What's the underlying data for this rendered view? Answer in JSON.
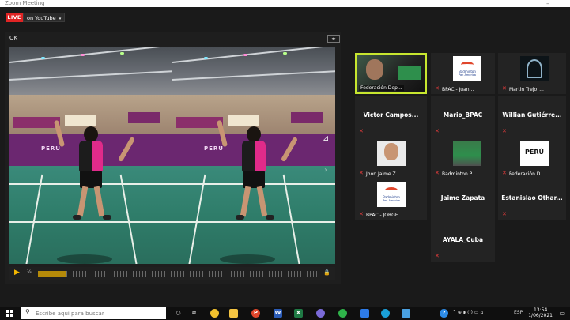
{
  "window": {
    "title": "Zoom Meeting",
    "minimize": "–"
  },
  "live": {
    "badge": "LIVE",
    "platform_button": "on YouTube",
    "caret": "▾"
  },
  "share": {
    "ok_label": "OK",
    "view_button": "◂▸",
    "controls": {
      "play": "▶",
      "speed": "¼",
      "progress_fraction": 0.1,
      "lock": "🔒"
    },
    "video_text": {
      "banner_logo": "PERU"
    }
  },
  "participants": [
    {
      "label": "Federación Dep...",
      "type": "video",
      "active": true,
      "muted": false
    },
    {
      "label": "BPAC - Juan...",
      "type": "logo",
      "muted": true
    },
    {
      "label": "Martin Trejo_...",
      "type": "logo",
      "muted": true
    },
    {
      "name": "Victor Campos...",
      "type": "name",
      "muted": true
    },
    {
      "name": "Mario_BPAC",
      "type": "name",
      "muted": true
    },
    {
      "name": "Willian Gutiérre...",
      "type": "name",
      "muted": true
    },
    {
      "label": "Jhon Jaime Z...",
      "type": "photo",
      "muted": true
    },
    {
      "label": "Badminton P...",
      "type": "photo",
      "muted": true
    },
    {
      "label": "Federación D...",
      "type": "logo",
      "muted": true
    },
    {
      "label": "BPAC - JORGE",
      "type": "logo",
      "muted": true
    },
    {
      "name": "Jaime Zapata",
      "type": "name",
      "muted": false
    },
    {
      "name": "Estanislao Othar...",
      "type": "name",
      "muted": true
    },
    {
      "name": "AYALA_Cuba",
      "type": "name",
      "muted": true
    }
  ],
  "logos": {
    "bpac_line1": "Badminton",
    "bpac_line2": "Pan America",
    "peru": "PERÚ"
  },
  "taskbar": {
    "search_placeholder": "Escribe aquí para buscar",
    "time": "13:54",
    "date": "1/06/2021",
    "language": "ESP",
    "tray_icons": "^ ⊕ ◗ ⟨)) ▭ ⌂"
  },
  "colors": {
    "live": "#e02424",
    "active_speaker": "#c7e62f",
    "mute": "#e23b3b",
    "progress": "#f5b800"
  }
}
